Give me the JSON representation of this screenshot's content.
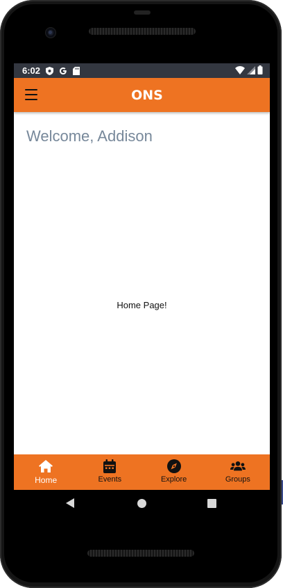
{
  "status_bar": {
    "time": "6:02",
    "left_icons": [
      "shield-icon",
      "google-g-icon",
      "sd-card-icon"
    ],
    "right_icons": [
      "wifi-icon",
      "cell-signal-icon",
      "battery-icon"
    ]
  },
  "app_bar": {
    "menu_icon": "hamburger-menu-icon",
    "logo_text": "ONS"
  },
  "main": {
    "welcome": "Welcome, Addison",
    "body_text": "Home Page!"
  },
  "bottom_nav": {
    "items": [
      {
        "label": "Home",
        "icon": "home-icon",
        "active": true
      },
      {
        "label": "Events",
        "icon": "calendar-icon",
        "active": false
      },
      {
        "label": "Explore",
        "icon": "compass-icon",
        "active": false
      },
      {
        "label": "Groups",
        "icon": "users-icon",
        "active": false
      }
    ]
  },
  "colors": {
    "accent": "#ee7322",
    "status_bar": "#333740",
    "welcome_text": "#77889a"
  }
}
